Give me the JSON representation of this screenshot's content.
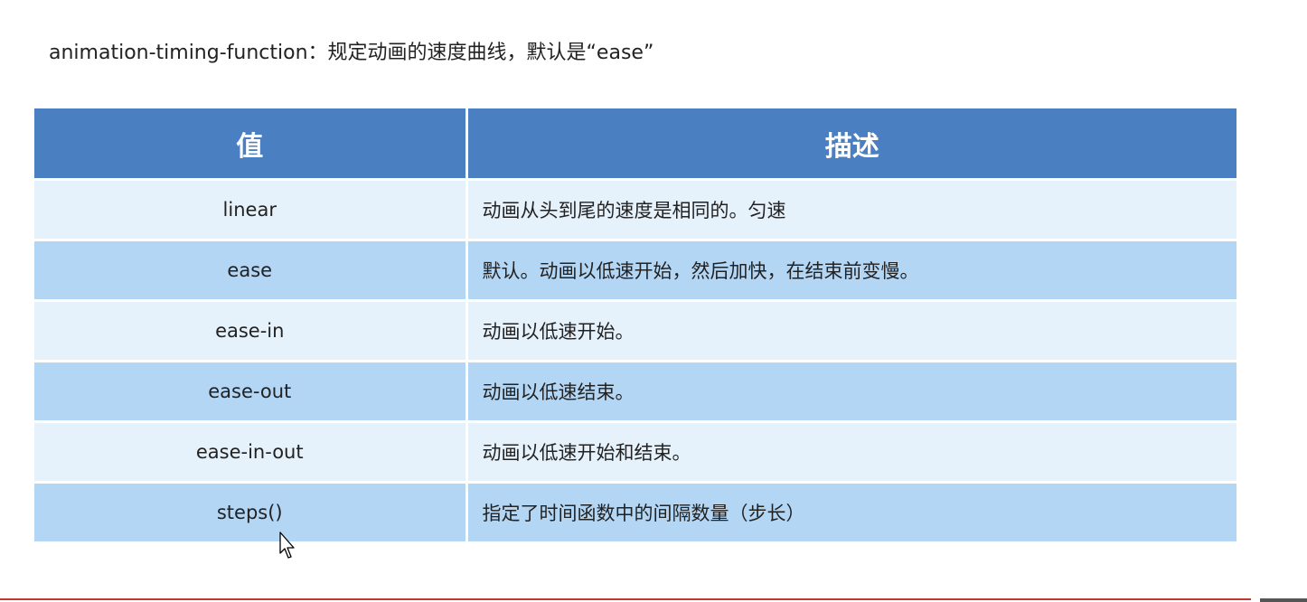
{
  "heading": "animation-timing-function：规定动画的速度曲线，默认是“ease”",
  "table": {
    "headers": [
      "值",
      "描述"
    ],
    "rows": [
      {
        "value": "linear",
        "description": "动画从头到尾的速度是相同的。匀速"
      },
      {
        "value": "ease",
        "description": "默认。动画以低速开始，然后加快，在结束前变慢。"
      },
      {
        "value": "ease-in",
        "description": "动画以低速开始。"
      },
      {
        "value": "ease-out",
        "description": "动画以低速结束。"
      },
      {
        "value": "ease-in-out",
        "description": "动画以低速开始和结束。"
      },
      {
        "value": "steps()",
        "description": "指定了时间函数中的间隔数量（步长）"
      }
    ]
  },
  "colors": {
    "header_bg": "#4a7fc1",
    "row_light": "#e6f2fb",
    "row_dark": "#b3d6f5",
    "bottom_line": "#c0392b"
  },
  "icons": [
    "mouse-cursor-icon"
  ]
}
